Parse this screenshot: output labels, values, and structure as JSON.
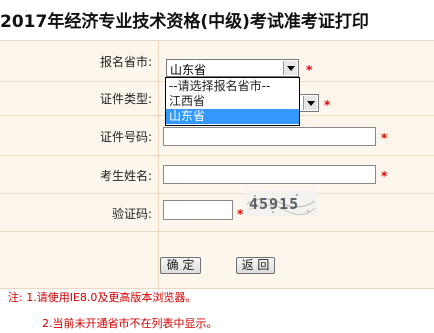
{
  "page": {
    "title": "2017年经济专业技术资格(中级)考试准考证打印"
  },
  "form": {
    "province": {
      "label": "报名省市:",
      "selected": "山东省",
      "options": [
        "--请选择报名省市--",
        "江西省",
        "山东省"
      ],
      "highlighted_option": "山东省"
    },
    "cert_type": {
      "label": "证件类型:"
    },
    "cert_number": {
      "label": "证件号码:",
      "value": ""
    },
    "name": {
      "label": "考生姓名:",
      "value": ""
    },
    "verify": {
      "label": "验证码:",
      "value": "",
      "captcha_text": "45915"
    },
    "required_mark": "*"
  },
  "buttons": {
    "confirm": "确 定",
    "back": "返 回"
  },
  "notes": {
    "line1": "注: 1.请使用IE8.0及更高版本浏览器。",
    "line2": "2.当前未开通省市不在列表中显示。"
  },
  "colors": {
    "form_background": "#fdf6ec",
    "required_star": "#e00000",
    "note_text": "#d40000",
    "selected_option": "#3399ff"
  }
}
